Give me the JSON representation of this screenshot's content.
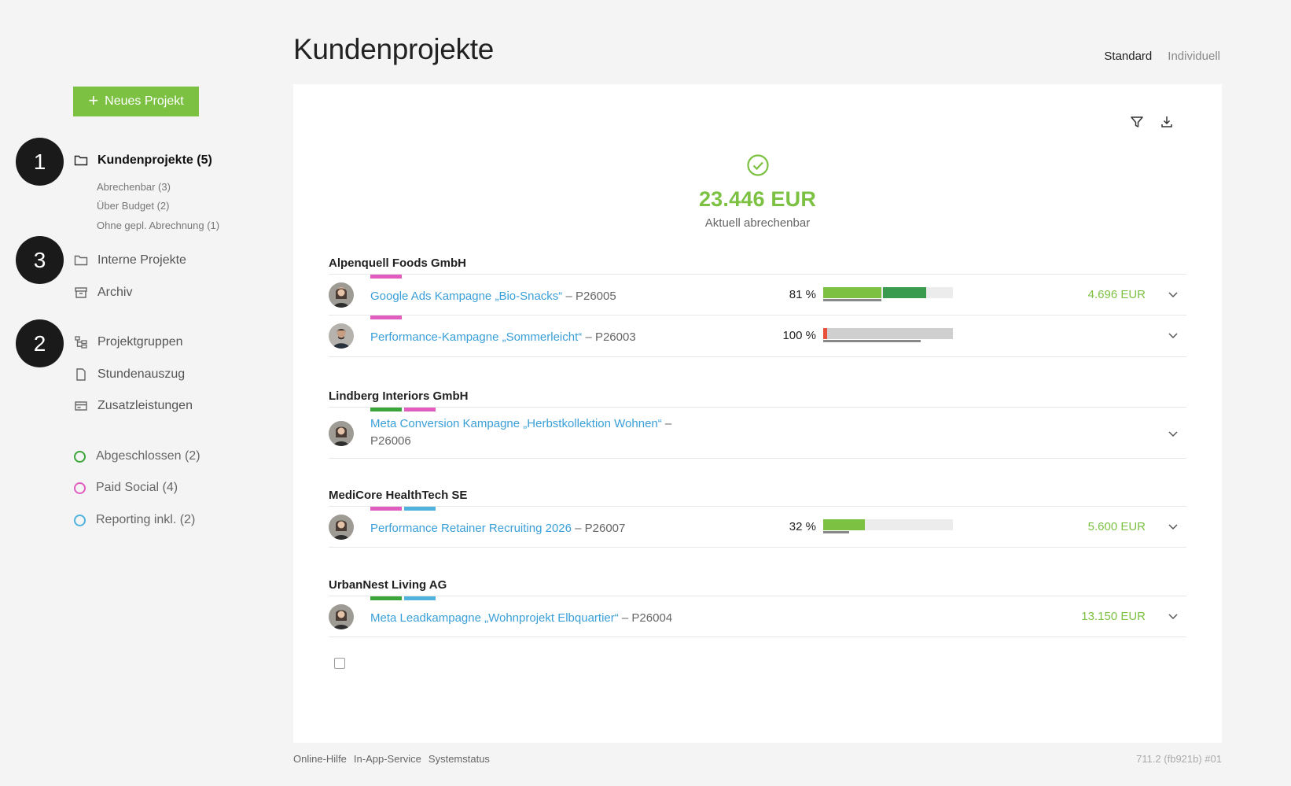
{
  "sidebar": {
    "new_project_label": "Neues Projekt",
    "badges": [
      "1",
      "3",
      "2"
    ],
    "nav": {
      "kundenprojekte": "Kundenprojekte (5)",
      "interne": "Interne Projekte",
      "archiv": "Archiv",
      "projektgruppen": "Projektgruppen",
      "stundenauszug": "Stundenauszug",
      "zusatzleistungen": "Zusatzleistungen"
    },
    "sub_items": [
      "Abrechenbar (3)",
      "Über Budget (2)",
      "Ohne gepl. Abrechnung (1)"
    ],
    "tags": [
      {
        "label": "Abgeschlossen (2)",
        "color": "#3aa63a"
      },
      {
        "label": "Paid Social (4)",
        "color": "#e05cbf"
      },
      {
        "label": "Reporting inkl. (2)",
        "color": "#4fb3de"
      }
    ]
  },
  "header": {
    "title": "Kundenprojekte",
    "views": [
      "Standard",
      "Individuell"
    ]
  },
  "summary": {
    "amount": "23.446 EUR",
    "label": "Aktuell abrechenbar"
  },
  "colors": {
    "green": "#7cc142",
    "dark_green": "#3a9a4e",
    "pink": "#e05cbf",
    "blue": "#4fb3de",
    "tag_green": "#3aa63a",
    "red": "#e8503a",
    "link": "#3a9fd8"
  },
  "clients": [
    {
      "name": "Alpenquell Foods GmbH",
      "projects": [
        {
          "title": "Google Ads Kampagne „Bio-Snacks“",
          "id": " – P26005",
          "percent": "81 %",
          "amount": "4.696 EUR",
          "tags": [
            "pink"
          ],
          "progress": 0.81,
          "billable": 0.45,
          "extra": 0.34,
          "under": 0.45
        },
        {
          "title": "Performance-Kampagne „Sommerleicht“",
          "id": " – P26003",
          "percent": "100 %",
          "amount": "",
          "tags": [
            "pink"
          ],
          "progress": 1.0,
          "billable": 0.0,
          "extra": 0.0,
          "under": 0.75,
          "over": true
        }
      ]
    },
    {
      "name": "Lindberg Interiors GmbH",
      "projects": [
        {
          "title": "Meta Conversion Kampagne „Herbstkollektion Wohnen“",
          "id": " – P26006",
          "percent": "",
          "amount": "",
          "tags": [
            "green",
            "pink"
          ]
        }
      ]
    },
    {
      "name": "MediCore HealthTech SE",
      "projects": [
        {
          "title": "Performance Retainer Recruiting 2026",
          "id": " – P26007",
          "percent": "32 %",
          "amount": "5.600 EUR",
          "tags": [
            "pink",
            "blue"
          ],
          "progress": 0.32,
          "billable": 0.32,
          "under": 0.2
        }
      ]
    },
    {
      "name": "UrbanNest Living AG",
      "projects": [
        {
          "title": "Meta Leadkampagne „Wohnprojekt Elbquartier“",
          "id": " – P26004",
          "percent": "",
          "amount": "13.150 EUR",
          "tags": [
            "green",
            "blue"
          ]
        }
      ]
    }
  ],
  "footer": {
    "links": [
      "Online-Hilfe",
      "In-App-Service",
      "Systemstatus"
    ],
    "version": "711.2 (fb921b) #01"
  }
}
